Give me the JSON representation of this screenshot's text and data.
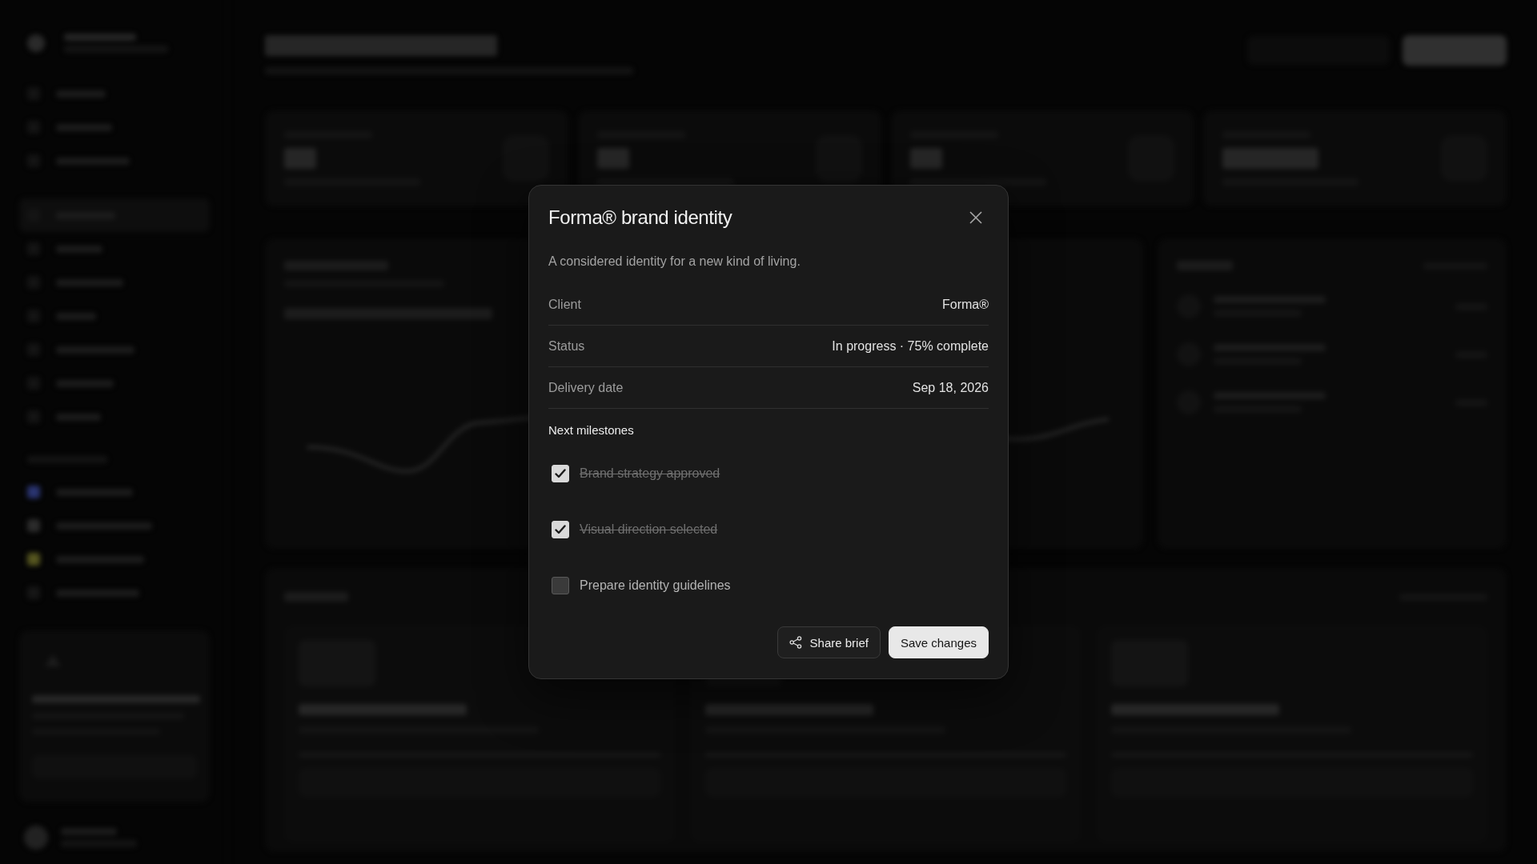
{
  "dialog": {
    "title": "Forma® brand identity",
    "description": "A considered identity for a new kind of living.",
    "details": [
      {
        "label": "Client",
        "value": "Forma®"
      },
      {
        "label": "Status",
        "value": "In progress · 75% complete"
      },
      {
        "label": "Delivery date",
        "value": "Sep 18, 2026"
      }
    ],
    "milestones_heading": "Next milestones",
    "milestones": [
      {
        "label": "Brand strategy approved",
        "checked": true
      },
      {
        "label": "Visual direction selected",
        "checked": true
      },
      {
        "label": "Prepare identity guidelines",
        "checked": false
      }
    ],
    "buttons": [
      {
        "label": "Share brief",
        "kind": "secondary"
      },
      {
        "label": "Save changes",
        "kind": "primary"
      }
    ]
  }
}
